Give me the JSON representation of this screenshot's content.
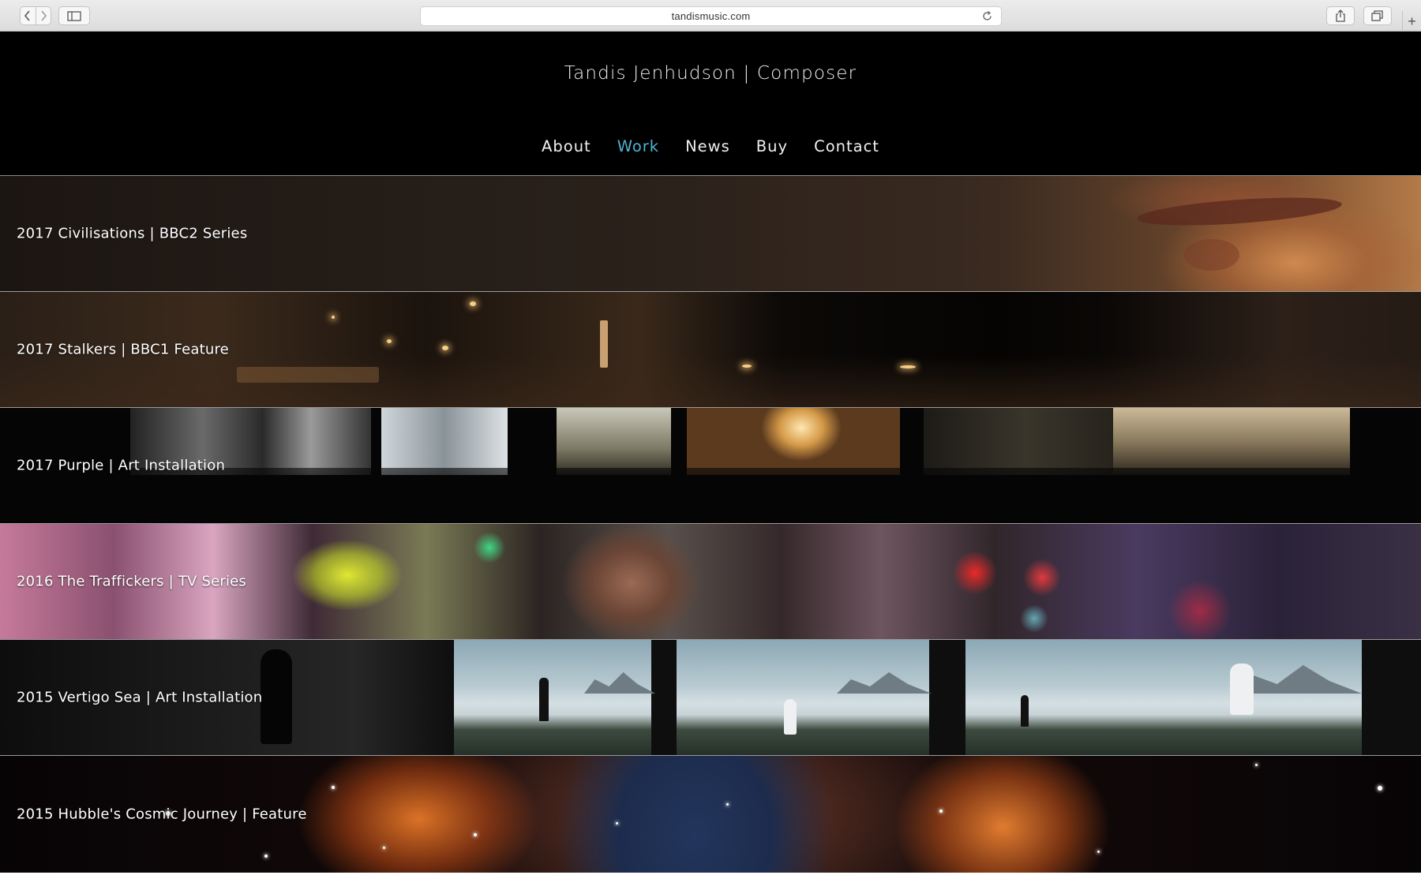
{
  "browser": {
    "url": "tandismusic.com",
    "icons": [
      "back-icon",
      "forward-icon",
      "sidebar-icon",
      "reload-icon",
      "share-icon",
      "tabs-icon",
      "new-tab-icon"
    ],
    "new_tab_label": "+"
  },
  "site": {
    "title": "Tandis Jenhudson | Composer",
    "nav": [
      {
        "label": "About",
        "active": false
      },
      {
        "label": "Work",
        "active": true
      },
      {
        "label": "News",
        "active": false
      },
      {
        "label": "Buy",
        "active": false
      },
      {
        "label": "Contact",
        "active": false
      }
    ],
    "accent_color": "#4fb3d3"
  },
  "work": [
    {
      "label": "2017 Civilisations | BBC2 Series"
    },
    {
      "label": "2017 Stalkers | BBC1 Feature"
    },
    {
      "label": "2017 Purple | Art Installation"
    },
    {
      "label": "2016 The Traffickers | TV Series"
    },
    {
      "label": "2015 Vertigo Sea | Art Installation"
    },
    {
      "label": "2015 Hubble's Cosmic Journey | Feature"
    }
  ]
}
